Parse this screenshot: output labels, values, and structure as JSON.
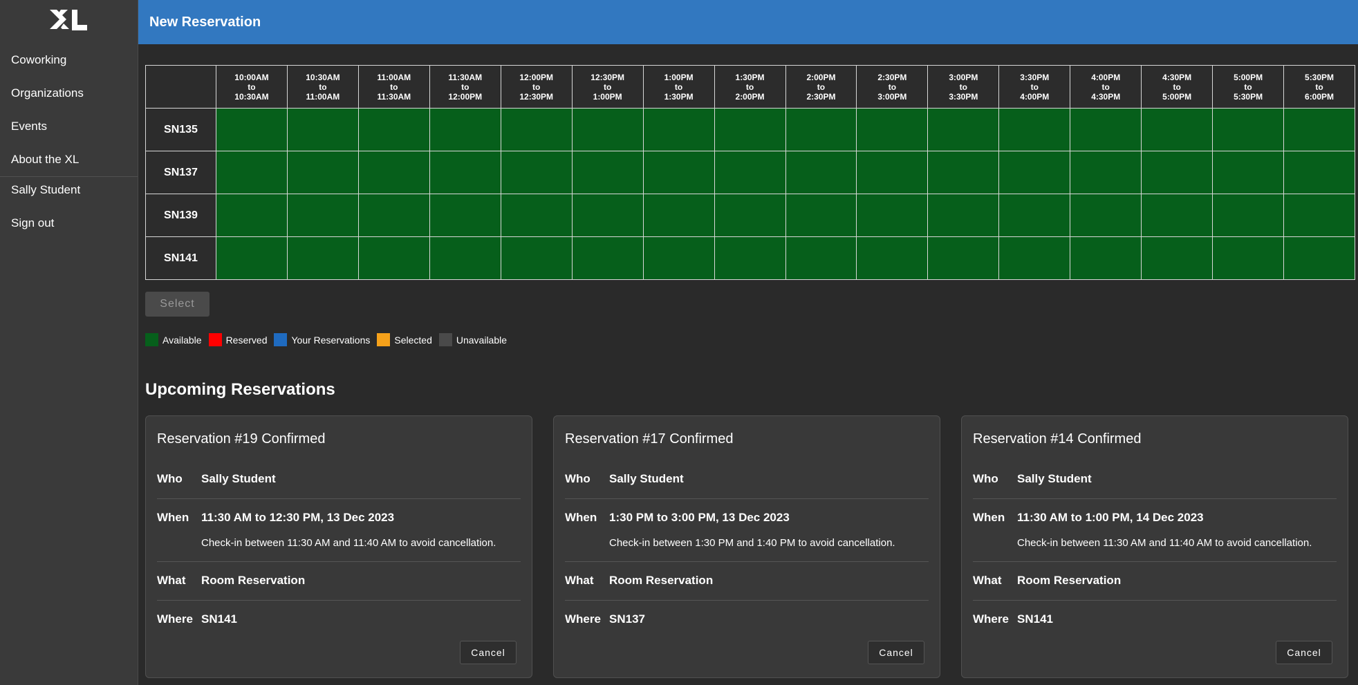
{
  "app": {
    "logo_text": "XL"
  },
  "sidebar": {
    "items": [
      {
        "label": "Coworking"
      },
      {
        "label": "Organizations"
      },
      {
        "label": "Events"
      },
      {
        "label": "About the XL"
      }
    ],
    "user_items": [
      {
        "label": "Sally Student"
      },
      {
        "label": "Sign out"
      }
    ]
  },
  "header": {
    "title": "New Reservation"
  },
  "grid": {
    "time_slots": [
      [
        "10:00AM",
        "to",
        "10:30AM"
      ],
      [
        "10:30AM",
        "to",
        "11:00AM"
      ],
      [
        "11:00AM",
        "to",
        "11:30AM"
      ],
      [
        "11:30AM",
        "to",
        "12:00PM"
      ],
      [
        "12:00PM",
        "to",
        "12:30PM"
      ],
      [
        "12:30PM",
        "to",
        "1:00PM"
      ],
      [
        "1:00PM",
        "to",
        "1:30PM"
      ],
      [
        "1:30PM",
        "to",
        "2:00PM"
      ],
      [
        "2:00PM",
        "to",
        "2:30PM"
      ],
      [
        "2:30PM",
        "to",
        "3:00PM"
      ],
      [
        "3:00PM",
        "to",
        "3:30PM"
      ],
      [
        "3:30PM",
        "to",
        "4:00PM"
      ],
      [
        "4:00PM",
        "to",
        "4:30PM"
      ],
      [
        "4:30PM",
        "to",
        "5:00PM"
      ],
      [
        "5:00PM",
        "to",
        "5:30PM"
      ],
      [
        "5:30PM",
        "to",
        "6:00PM"
      ]
    ],
    "rooms": [
      "SN135",
      "SN137",
      "SN139",
      "SN141"
    ],
    "cell_status": "available"
  },
  "select_button": {
    "label": "Select"
  },
  "legend": [
    {
      "label": "Available",
      "color": "#065f1b"
    },
    {
      "label": "Reserved",
      "color": "#ff0000"
    },
    {
      "label": "Your Reservations",
      "color": "#1f6bc0"
    },
    {
      "label": "Selected",
      "color": "#f5a11a"
    },
    {
      "label": "Unavailable",
      "color": "#4a4a4a"
    }
  ],
  "upcoming": {
    "title": "Upcoming Reservations",
    "labels": {
      "who": "Who",
      "when": "When",
      "what": "What",
      "where": "Where"
    },
    "cancel_label": "Cancel",
    "cards": [
      {
        "title": "Reservation #19 Confirmed",
        "who": "Sally Student",
        "when": "11:30 AM to 12:30 PM, 13 Dec 2023",
        "checkin": "Check-in between 11:30 AM and 11:40 AM to avoid cancellation.",
        "what": "Room Reservation",
        "where": "SN141"
      },
      {
        "title": "Reservation #17 Confirmed",
        "who": "Sally Student",
        "when": "1:30 PM to 3:00 PM, 13 Dec 2023",
        "checkin": "Check-in between 1:30 PM and 1:40 PM to avoid cancellation.",
        "what": "Room Reservation",
        "where": "SN137"
      },
      {
        "title": "Reservation #14 Confirmed",
        "who": "Sally Student",
        "when": "11:30 AM to 1:00 PM, 14 Dec 2023",
        "checkin": "Check-in between 11:30 AM and 11:40 AM to avoid cancellation.",
        "what": "Room Reservation",
        "where": "SN141"
      }
    ]
  }
}
